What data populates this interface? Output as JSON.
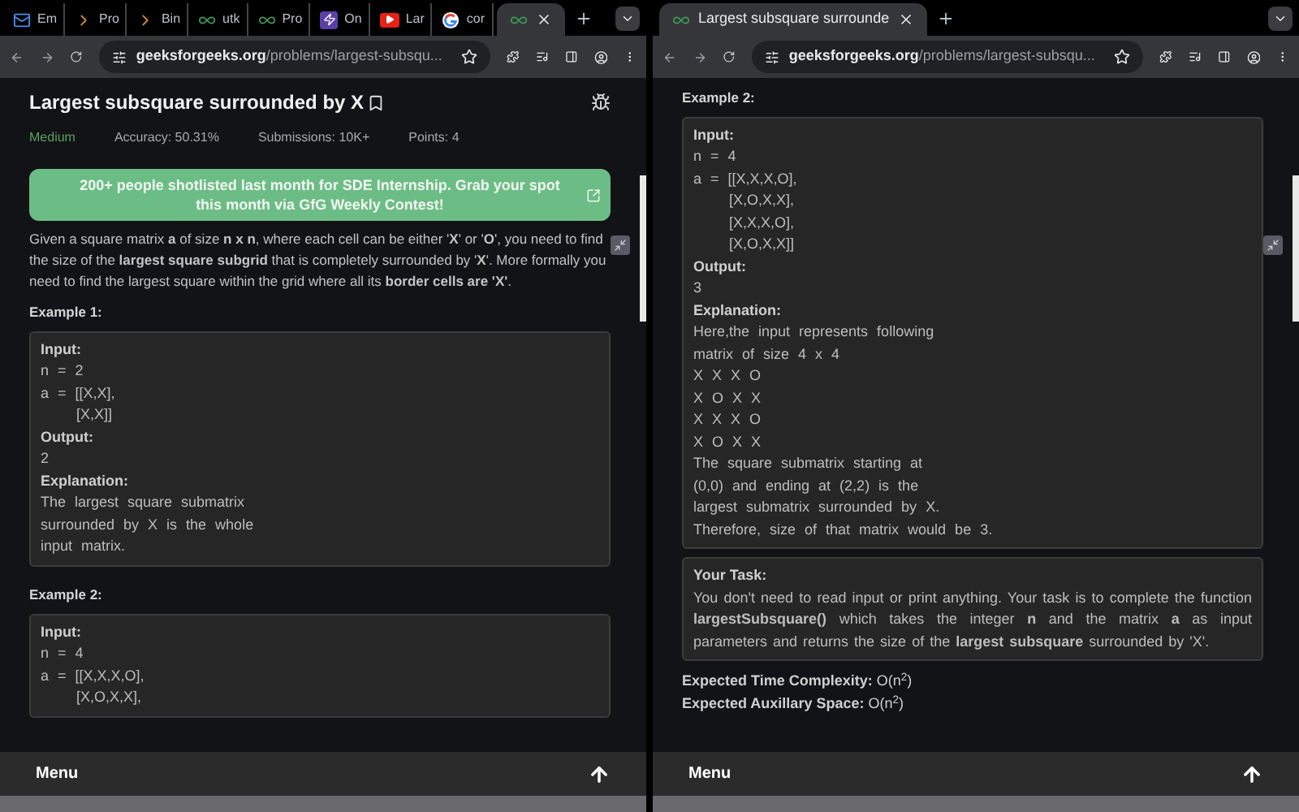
{
  "windows": [
    {
      "tabs": [
        {
          "kind": "mail",
          "label": "Em",
          "selected": false
        },
        {
          "kind": "chevron",
          "label": "Pro",
          "selected": false
        },
        {
          "kind": "chevron",
          "label": "Bin",
          "selected": false
        },
        {
          "kind": "gfg",
          "label": "utk",
          "selected": false
        },
        {
          "kind": "gfg",
          "label": "Pro",
          "selected": false
        },
        {
          "kind": "bolt",
          "label": "On",
          "selected": false
        },
        {
          "kind": "video",
          "label": "Lar",
          "selected": false
        },
        {
          "kind": "ring",
          "label": "cor",
          "selected": false
        },
        {
          "kind": "gfg",
          "selected": true
        }
      ],
      "url_host": "geeksforgeeks.org",
      "url_path": "/problems/largest-subsqu...",
      "blocks": [
        {
          "kind": "title",
          "text": "Largest subsquare surrounded by X"
        },
        {
          "kind": "stats",
          "difficulty": "Medium",
          "items": [
            "Accuracy: 50.31%",
            "Submissions: 10K+",
            "Points: 4"
          ]
        },
        {
          "kind": "banner",
          "text": "200+ people shotlisted last month for SDE Internship. Grab your spot this month via GfG Weekly Contest!"
        },
        {
          "kind": "paragraph",
          "text": "Given a square matrix **a** of size **n x n**, where each cell can be either '**X**' or '**O**', you need to find the size of the **largest square subgrid** that is completely surrounded by '**X**'. More formally you need to find the largest square within the grid where all its **border cells are 'X'**."
        },
        {
          "kind": "heading",
          "text": "Example 1:"
        },
        {
          "kind": "box",
          "lines": [
            {
              "kind": "label",
              "text": "Input:"
            },
            {
              "kind": "text",
              "text": "n = 2"
            },
            {
              "kind": "text",
              "text": "a = [[X,X],"
            },
            {
              "kind": "indent",
              "text": "[X,X]]"
            },
            {
              "kind": "label",
              "text": "Output:"
            },
            {
              "kind": "text",
              "text": "2"
            },
            {
              "kind": "label",
              "text": "Explanation:"
            },
            {
              "kind": "text",
              "text": "The largest square submatrix"
            },
            {
              "kind": "text",
              "text": "surrounded by X is the whole"
            },
            {
              "kind": "text",
              "text": "input matrix."
            }
          ]
        },
        {
          "kind": "heading",
          "text": "Example 2:"
        },
        {
          "kind": "box",
          "lines": [
            {
              "kind": "label",
              "text": "Input:"
            },
            {
              "kind": "text",
              "text": "n = 4"
            },
            {
              "kind": "text",
              "text": "a = [[X,X,X,O],"
            },
            {
              "kind": "indent",
              "text": "[X,O,X,X],"
            }
          ]
        }
      ],
      "menu_label": "Menu"
    },
    {
      "tabs": [
        {
          "kind": "gfg",
          "label": "Largest subsquare surrounde",
          "selected": true
        }
      ],
      "url_host": "geeksforgeeks.org",
      "url_path": "/problems/largest-subsqu...",
      "blocks": [
        {
          "kind": "heading",
          "text": "Example 2:"
        },
        {
          "kind": "box",
          "lines": [
            {
              "kind": "label",
              "text": "Input:"
            },
            {
              "kind": "text",
              "text": "n = 4"
            },
            {
              "kind": "text",
              "text": "a = [[X,X,X,O],"
            },
            {
              "kind": "indent",
              "text": "[X,O,X,X],"
            },
            {
              "kind": "indent",
              "text": "[X,X,X,O],"
            },
            {
              "kind": "indent",
              "text": "[X,O,X,X]]"
            },
            {
              "kind": "label",
              "text": "Output:"
            },
            {
              "kind": "text",
              "text": "3"
            },
            {
              "kind": "label",
              "text": "Explanation:"
            },
            {
              "kind": "text",
              "text": "Here,the input represents following"
            },
            {
              "kind": "text",
              "text": "matrix of size 4 x 4"
            },
            {
              "kind": "text",
              "text": "X X X O"
            },
            {
              "kind": "text",
              "text": "X O X X"
            },
            {
              "kind": "text",
              "text": "X X X O"
            },
            {
              "kind": "text",
              "text": "X O X X"
            },
            {
              "kind": "text",
              "text": "The square submatrix starting at"
            },
            {
              "kind": "text",
              "text": "(0,0) and ending at (2,2) is the"
            },
            {
              "kind": "text",
              "text": "largest submatrix surrounded by X."
            },
            {
              "kind": "text",
              "text": "Therefore, size of that matrix would be 3."
            }
          ]
        },
        {
          "kind": "box",
          "lines": [
            {
              "kind": "label",
              "text": "Your Task:"
            },
            {
              "kind": "para",
              "text": "You don't need to read input or print anything. Your task is to complete the function **largestSubsquare()** which takes the integer **n** and the matrix **a** as input parameters and returns the size of the **largest subsquare** surrounded by 'X'."
            }
          ]
        },
        {
          "kind": "note",
          "text": "**Expected Time Complexity:** O(n$^{2}$)"
        },
        {
          "kind": "note",
          "text": "**Expected Auxillary Space:** O(n$^{2}$)"
        }
      ],
      "menu_label": "Menu"
    }
  ]
}
